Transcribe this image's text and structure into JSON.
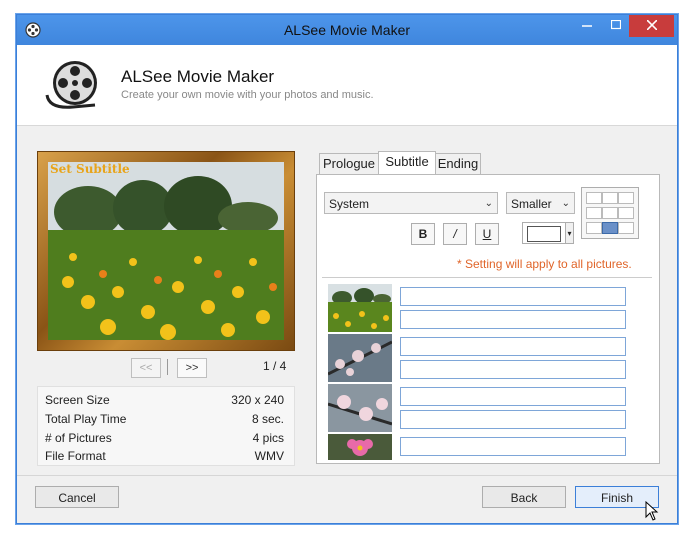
{
  "window": {
    "title": "ALSee Movie Maker"
  },
  "header": {
    "title": "ALSee Movie Maker",
    "subtitle": "Create your own movie with your photos and music."
  },
  "preview": {
    "subtitle_overlay": "Set Subtitle",
    "prev_label": "<<",
    "next_label": ">>",
    "page_indicator": "1 / 4"
  },
  "info": [
    {
      "key": "Screen Size",
      "value": "320 x 240"
    },
    {
      "key": "Total Play Time",
      "value": "8 sec."
    },
    {
      "key": "# of Pictures",
      "value": "4 pics"
    },
    {
      "key": "File Format",
      "value": "WMV"
    }
  ],
  "tabs": [
    {
      "label": "Prologue",
      "active": false
    },
    {
      "label": "Subtitle",
      "active": true
    },
    {
      "label": "Ending",
      "active": false
    }
  ],
  "subtitle_panel": {
    "font_select": "System",
    "size_select": "Smaller",
    "bold_label": "B",
    "italic_label": "/",
    "underline_label": "U",
    "text_color": "#ffffff",
    "selected_alignment": "bottom-center",
    "note": "* Setting will apply to all pictures.",
    "entries": [
      {
        "thumb": "flower-field",
        "line1": "",
        "line2": ""
      },
      {
        "thumb": "pink-blossom-branch",
        "line1": "",
        "line2": ""
      },
      {
        "thumb": "pink-blossom-close",
        "line1": "",
        "line2": ""
      },
      {
        "thumb": "pink-flower",
        "line1": ""
      }
    ]
  },
  "footer": {
    "cancel_label": "Cancel",
    "back_label": "Back",
    "finish_label": "Finish"
  },
  "colors": {
    "titlebar": "#4a90e2",
    "note": "#e0652a",
    "frame": "#a8701f"
  }
}
